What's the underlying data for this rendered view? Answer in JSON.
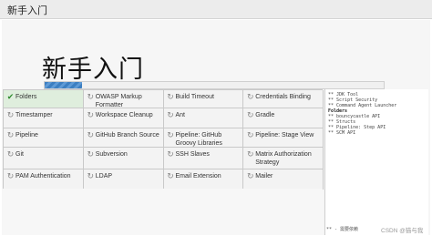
{
  "window": {
    "title": "新手入门"
  },
  "hero": {
    "title": "新手入门"
  },
  "install_progress": {
    "fraction": 0.11
  },
  "plugins": [
    {
      "label": "Folders",
      "status": "done"
    },
    {
      "label": "OWASP Markup Formatter",
      "status": "pending"
    },
    {
      "label": "Build Timeout",
      "status": "pending"
    },
    {
      "label": "Credentials Binding",
      "status": "pending"
    },
    {
      "label": "Timestamper",
      "status": "pending"
    },
    {
      "label": "Workspace Cleanup",
      "status": "pending"
    },
    {
      "label": "Ant",
      "status": "pending"
    },
    {
      "label": "Gradle",
      "status": "pending"
    },
    {
      "label": "Pipeline",
      "status": "pending"
    },
    {
      "label": "GitHub Branch Source",
      "status": "pending"
    },
    {
      "label": "Pipeline: GitHub Groovy Libraries",
      "status": "pending"
    },
    {
      "label": "Pipeline: Stage View",
      "status": "pending"
    },
    {
      "label": "Git",
      "status": "pending"
    },
    {
      "label": "Subversion",
      "status": "pending"
    },
    {
      "label": "SSH Slaves",
      "status": "pending"
    },
    {
      "label": "Matrix Authorization Strategy",
      "status": "pending"
    },
    {
      "label": "PAM Authentication",
      "status": "pending"
    },
    {
      "label": "LDAP",
      "status": "pending"
    },
    {
      "label": "Email Extension",
      "status": "pending"
    },
    {
      "label": "Mailer",
      "status": "pending"
    }
  ],
  "install_log": {
    "lines": [
      {
        "text": "** JDK Tool",
        "bold": false
      },
      {
        "text": "** Script Security",
        "bold": false
      },
      {
        "text": "** Command Agent Launcher",
        "bold": false
      },
      {
        "text": "Folders",
        "bold": true
      },
      {
        "text": "** bouncycastle API",
        "bold": false
      },
      {
        "text": "** Structs",
        "bold": false
      },
      {
        "text": "** Pipeline: Step API",
        "bold": false
      },
      {
        "text": "** SCM API",
        "bold": false
      }
    ],
    "footer": "** - 需要依赖"
  },
  "watermark": "CSDN @猫与我",
  "icons": {
    "done": "check-icon",
    "pending": "refresh-icon"
  }
}
